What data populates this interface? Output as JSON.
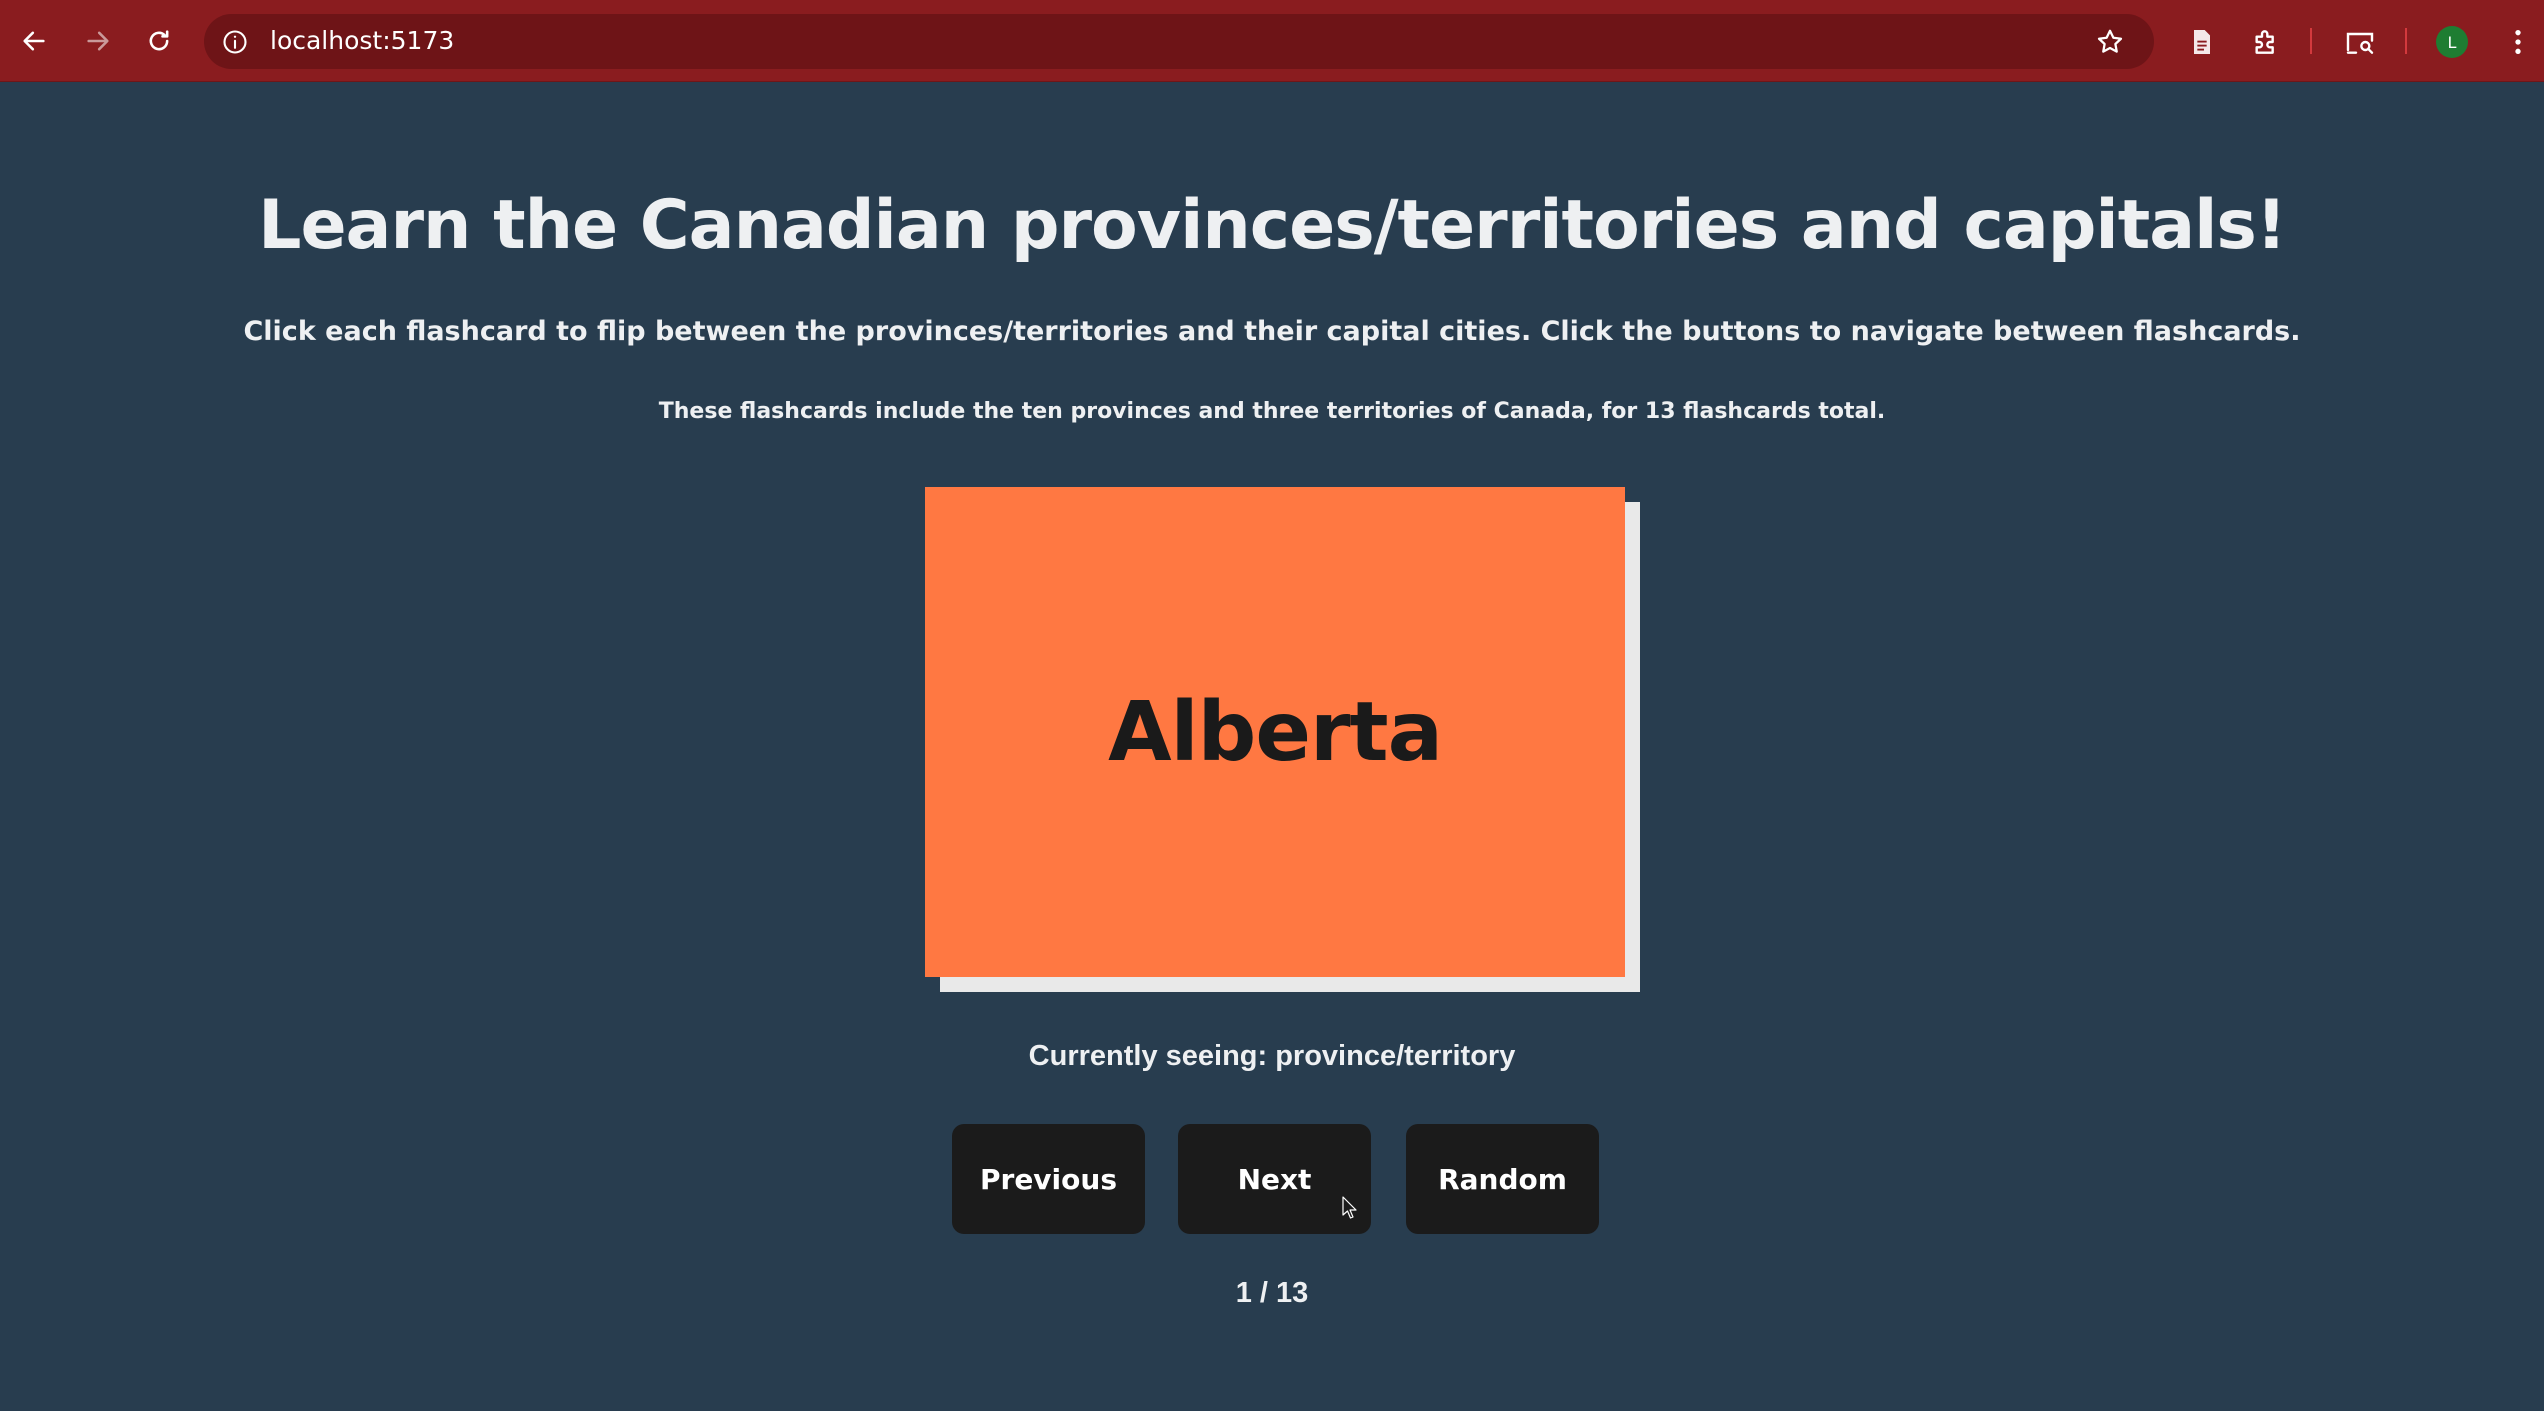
{
  "browser": {
    "url": "localhost:5173",
    "avatar_initial": "L",
    "icons": {
      "back": "arrow-left-icon",
      "forward": "arrow-right-icon",
      "reload": "reload-icon",
      "site_info": "info-icon",
      "bookmark": "star-icon",
      "reading": "document-icon",
      "extensions": "puzzle-icon",
      "cast": "cast-search-icon",
      "menu": "kebab-menu-icon"
    },
    "colors": {
      "toolbar": "#8a1c1f",
      "omnibox": "#6e1417",
      "avatar": "#1e7d32"
    }
  },
  "page": {
    "title": "Learn the Canadian provinces/territories and capitals!",
    "instructions": "Click each flashcard to flip between the provinces/territories and their capital cities. Click the buttons to navigate between flashcards.",
    "description": "These flashcards include the ten provinces and three territories of Canada, for 13 flashcards total.",
    "colors": {
      "background": "#283d4f",
      "card": "#ff7842",
      "card_shadow": "#e9e9e9",
      "button": "#1b1b1b"
    }
  },
  "flashcard": {
    "text": "Alberta"
  },
  "status": {
    "text": "Currently seeing: province/territory"
  },
  "buttons": {
    "previous": "Previous",
    "next": "Next",
    "random": "Random"
  },
  "counter": {
    "text": "1 / 13"
  }
}
